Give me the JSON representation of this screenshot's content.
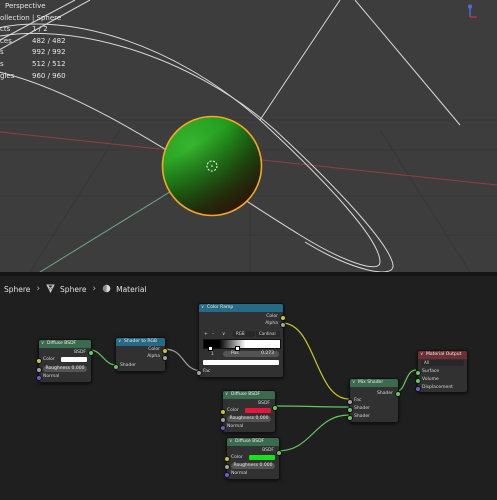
{
  "viewport": {
    "view_name": "Perspective",
    "collection_path": "ollection | Sphere",
    "stats": [
      {
        "label": "cts",
        "value": "1 / 2"
      },
      {
        "label": "ces",
        "value": "482 / 482"
      },
      {
        "label": "s",
        "value": "992 / 992"
      },
      {
        "label": "s",
        "value": "512 / 512"
      },
      {
        "label": "gles",
        "value": "960 / 960"
      }
    ]
  },
  "node_editor": {
    "breadcrumb": {
      "object": "Sphere",
      "mesh": "Sphere",
      "material": "Material"
    },
    "nodes": {
      "diffuse_white": {
        "title": "Diffuse BSDF",
        "output": "BSDF",
        "color_label": "Color",
        "roughness_label": "Roughness",
        "roughness_value": "0.000",
        "normal_label": "Normal",
        "color": "#ffffff"
      },
      "shader_to_rgb": {
        "title": "Shader to RGB",
        "out_color": "Color",
        "out_alpha": "Alpha",
        "in_shader": "Shader"
      },
      "color_ramp": {
        "title": "Color Ramp",
        "out_color": "Color",
        "out_alpha": "Alpha",
        "plus": "+",
        "minus": "–",
        "dropdown": "∨",
        "mode": "RGB",
        "interp": "Cardinal",
        "stop_index": "1",
        "pos_label": "Pos",
        "pos_value": "0.273",
        "in_fac": "Fac"
      },
      "diffuse_red": {
        "title": "Diffuse BSDF",
        "output": "BSDF",
        "color_label": "Color",
        "roughness_label": "Roughness",
        "roughness_value": "0.000",
        "normal_label": "Normal",
        "color": "#e8153a"
      },
      "diffuse_green": {
        "title": "Diffuse BSDF",
        "output": "BSDF",
        "color_label": "Color",
        "roughness_label": "Roughness",
        "roughness_value": "0.000",
        "normal_label": "Normal",
        "color": "#19e01c"
      },
      "mix_shader": {
        "title": "Mix Shader",
        "output": "Shader",
        "in_fac": "Fac",
        "in_shader1": "Shader",
        "in_shader2": "Shader"
      },
      "material_output": {
        "title": "Material Output",
        "target": "All",
        "in_surface": "Surface",
        "in_volume": "Volume",
        "in_displacement": "Displacement"
      }
    }
  },
  "colors": {
    "viewport_bg": "#3d3d3d",
    "editor_bg": "#1f1f1f",
    "selection_orange": "#f5a623",
    "shader_header": "#3a6b4f",
    "converter_header": "#276a86",
    "output_header": "#6e2f34",
    "wire_green": "#63c763"
  }
}
